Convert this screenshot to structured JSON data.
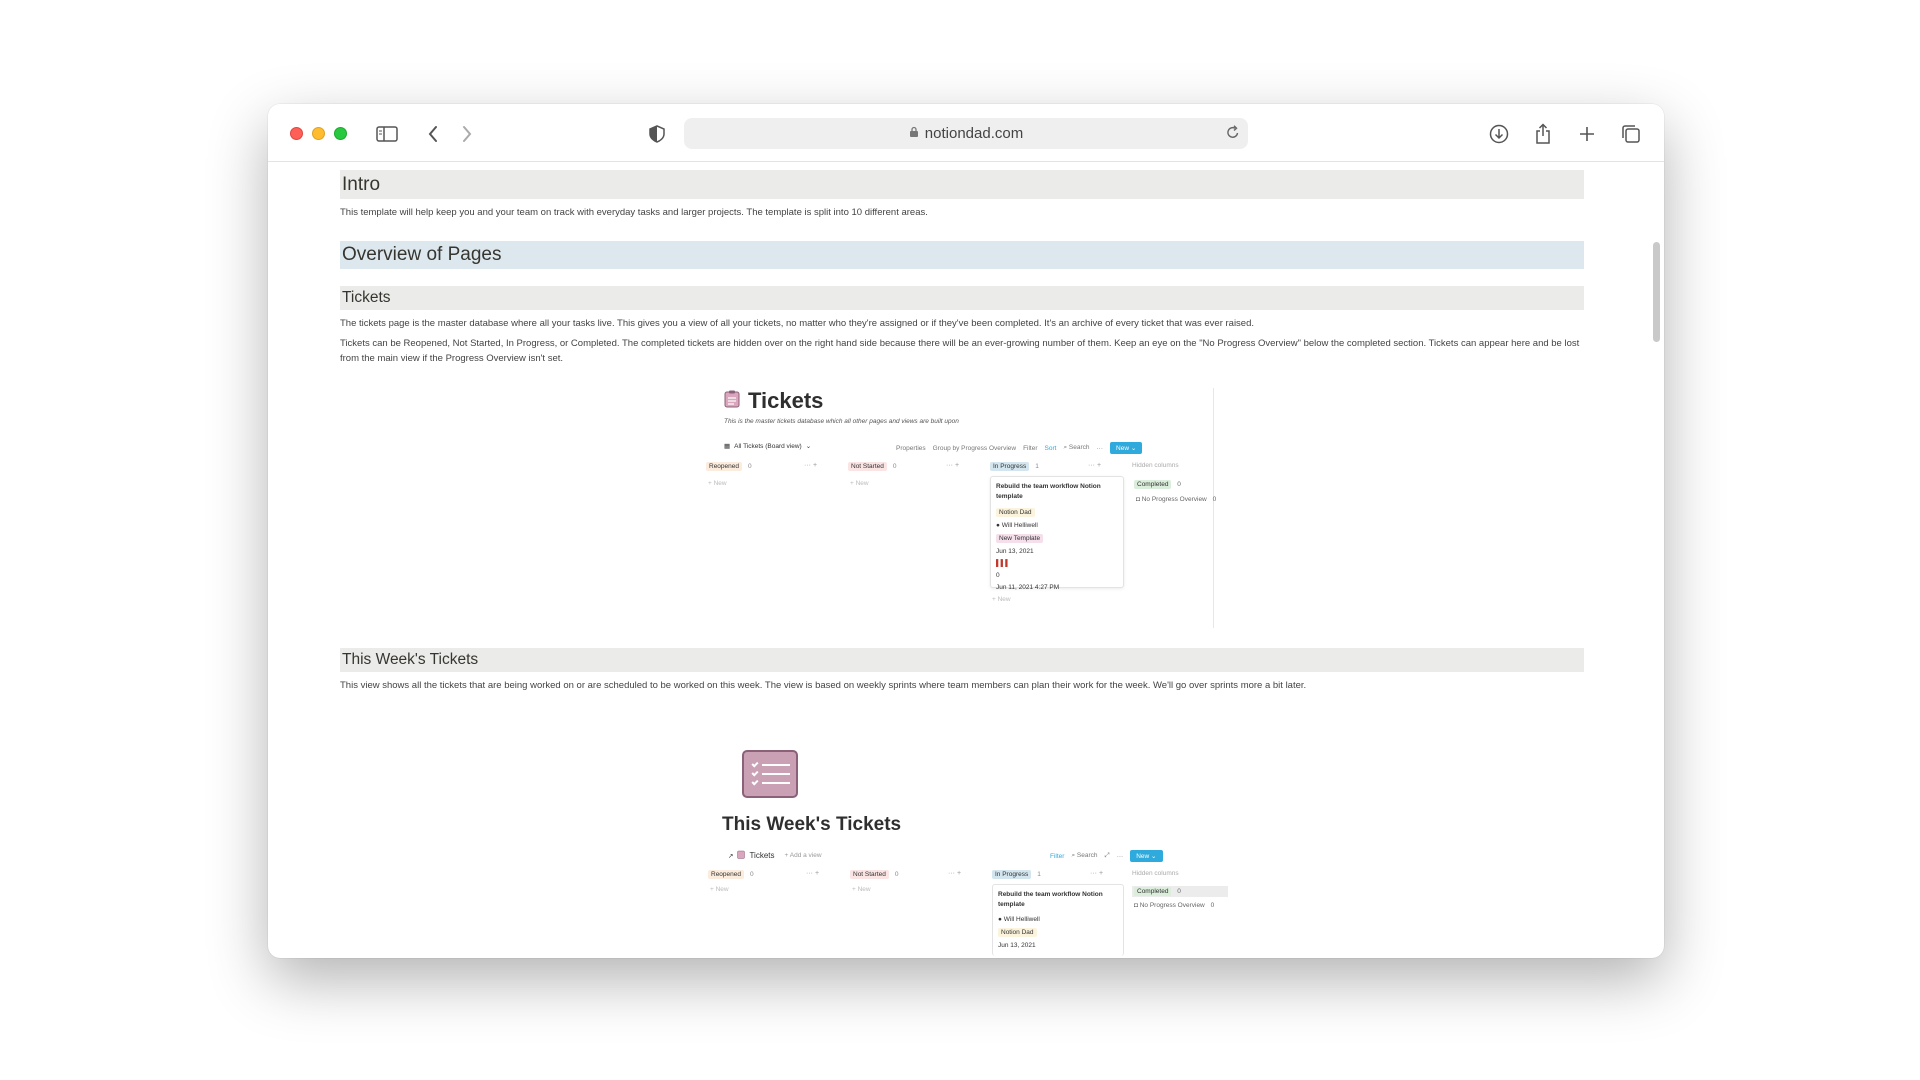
{
  "browser": {
    "url": "notiondad.com"
  },
  "page": {
    "intro": {
      "heading": "Intro",
      "text": "This template will help keep you and your team on track with everyday tasks and larger projects. The template is split into 10 different areas."
    },
    "overview": {
      "heading": "Overview of Pages"
    },
    "tickets": {
      "heading": "Tickets",
      "p1": "The tickets page is the master database where all your tasks live. This gives you a view of all your tickets, no matter who they're assigned or if they've been completed. It's an archive of every ticket that was ever raised.",
      "p2": "Tickets can be Reopened, Not Started, In Progress, or Completed. The completed tickets are hidden over on the right hand side because there will be an ever-growing number of them. Keep an eye on the \"No Progress Overview\" below the completed section. Tickets can appear here and be lost from the main view if the Progress Overview isn't set."
    },
    "this_week": {
      "heading": "This Week's Tickets",
      "text": "This view shows all the tickets that are being worked on or are scheduled to be worked on this week. The view is based on weekly sprints where team members can plan their work for the week. We'll go over sprints more a bit later."
    },
    "help": "?"
  },
  "embed1": {
    "title": "Tickets",
    "subtitle": "This is the master tickets database which all other pages and views are built upon",
    "view_name": "All Tickets (Board view)",
    "toolbar": [
      "Properties",
      "Group by Progress Overview",
      "Filter",
      "Sort",
      "Search",
      "···"
    ],
    "new_label": "New",
    "columns": [
      {
        "label": "Reopened",
        "count": "0",
        "color": "#fbecdd"
      },
      {
        "label": "Not Started",
        "count": "0",
        "color": "#fbe4e4"
      },
      {
        "label": "In Progress",
        "count": "1",
        "color": "#d3e5ef"
      }
    ],
    "add_new": "+ New",
    "hidden_label": "Hidden columns",
    "hidden_items": [
      {
        "label": "Completed",
        "count": "0",
        "color": "#dbeddb"
      },
      {
        "label": "No Progress Overview",
        "count": "0"
      }
    ],
    "card": {
      "title": "Rebuild the team workflow Notion template",
      "tag1": "Notion Dad",
      "person": "Will Helliwell",
      "tag2": "New Template",
      "date": "Jun 13, 2021",
      "num": "0",
      "created": "Jun 11, 2021 4:27 PM"
    }
  },
  "embed2": {
    "title": "This Week's Tickets",
    "link": "Tickets",
    "add_view": "+ Add a view",
    "toolbar": [
      "Filter",
      "Search",
      "···"
    ],
    "new_label": "New",
    "columns": [
      {
        "label": "Reopened",
        "count": "0",
        "color": "#fbecdd"
      },
      {
        "label": "Not Started",
        "count": "0",
        "color": "#fbe4e4"
      },
      {
        "label": "In Progress",
        "count": "1",
        "color": "#d3e5ef"
      }
    ],
    "add_new": "+ New",
    "hidden_label": "Hidden columns",
    "hidden_items": [
      {
        "label": "Completed",
        "count": "0",
        "color": "#dbeddb"
      },
      {
        "label": "No Progress Overview",
        "count": "0"
      }
    ],
    "card": {
      "title": "Rebuild the team workflow Notion template",
      "person": "Will Helliwell",
      "tag1": "Notion Dad",
      "date": "Jun 13, 2021"
    }
  }
}
